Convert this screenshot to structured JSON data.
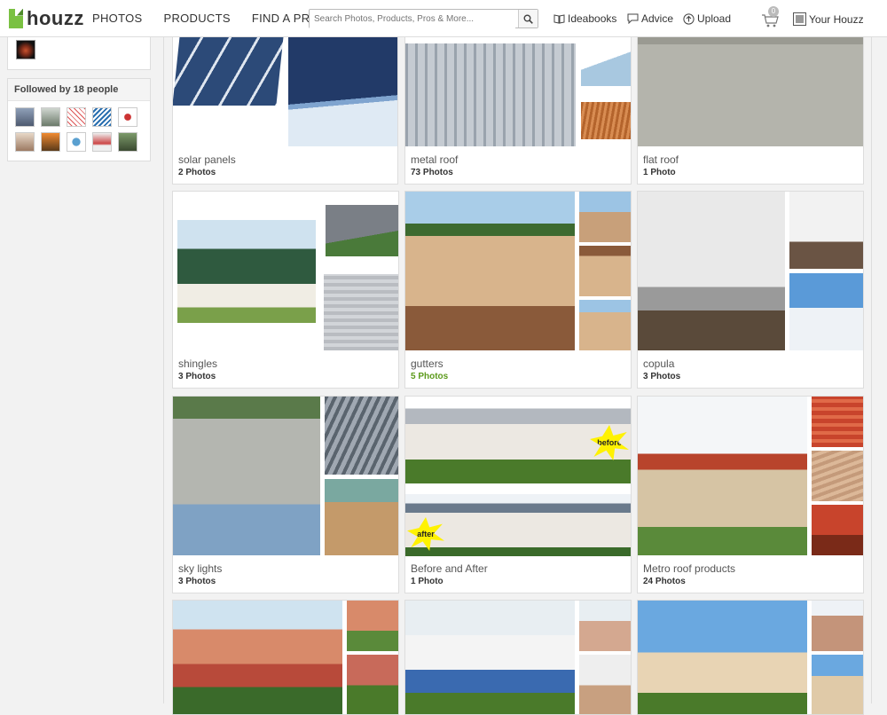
{
  "header": {
    "logo_text": "houzz",
    "nav": [
      "PHOTOS",
      "PRODUCTS",
      "FIND A PRO"
    ],
    "search_placeholder": "Search Photos, Products, Pros & More...",
    "ideabooks": "Ideabooks",
    "advice": "Advice",
    "upload": "Upload",
    "cart_count": "0",
    "your_houzz": "Your Houzz"
  },
  "sidebar": {
    "followed_label": "Followed by 18 people"
  },
  "cards": [
    {
      "title": "solar panels",
      "count": "2 Photos"
    },
    {
      "title": "metal roof",
      "count": "73 Photos"
    },
    {
      "title": "flat roof",
      "count": "1 Photo"
    },
    {
      "title": "shingles",
      "count": "3 Photos"
    },
    {
      "title": "gutters",
      "count": "5 Photos"
    },
    {
      "title": "copula",
      "count": "3 Photos"
    },
    {
      "title": "sky lights",
      "count": "3 Photos"
    },
    {
      "title": "Before and After",
      "count": "1 Photo"
    },
    {
      "title": "Metro roof products",
      "count": "24 Photos"
    }
  ],
  "badges": {
    "before": "before",
    "after": "after"
  },
  "colors": {
    "brand_green": "#7ac142",
    "count_green": "#5c9a1b"
  }
}
